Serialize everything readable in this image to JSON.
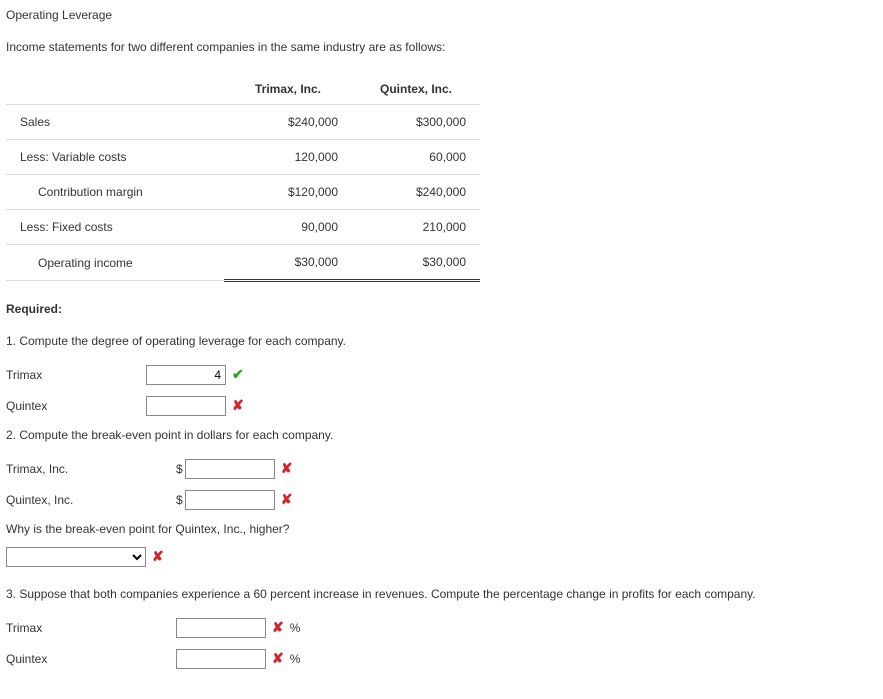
{
  "title": "Operating Leverage",
  "intro": "Income statements for two different companies in the same industry are as follows:",
  "table": {
    "headers": {
      "c1": "Trimax, Inc.",
      "c2": "Quintex, Inc."
    },
    "rows": {
      "sales": {
        "label": "Sales",
        "c1": "$240,000",
        "c2": "$300,000"
      },
      "varcost": {
        "label": "Less: Variable costs",
        "c1": "120,000",
        "c2": "60,000"
      },
      "contrib": {
        "label": "Contribution margin",
        "c1": "$120,000",
        "c2": "$240,000"
      },
      "fixcost": {
        "label": "Less: Fixed costs",
        "c1": "90,000",
        "c2": "210,000"
      },
      "opinc": {
        "label": "Operating income",
        "c1": "$30,000",
        "c2": "$30,000"
      }
    }
  },
  "required_label": "Required:",
  "q1": {
    "prompt": "1. Compute the degree of operating leverage for each company.",
    "trimax_label": "Trimax",
    "trimax_value": "4",
    "quintex_label": "Quintex",
    "quintex_value": ""
  },
  "q2": {
    "prompt": "2. Compute the break-even point in dollars for each company.",
    "trimax_label": "Trimax, Inc.",
    "quintex_label": "Quintex, Inc.",
    "currency": "$",
    "why_prompt": "Why is the break-even point for Quintex, Inc., higher?"
  },
  "q3": {
    "prompt": "3. Suppose that both companies experience a 60 percent increase in revenues. Compute the percentage change in profits for each company.",
    "trimax_label": "Trimax",
    "quintex_label": "Quintex",
    "pct": "%"
  },
  "marks": {
    "check": "✔",
    "cross": "✘"
  }
}
